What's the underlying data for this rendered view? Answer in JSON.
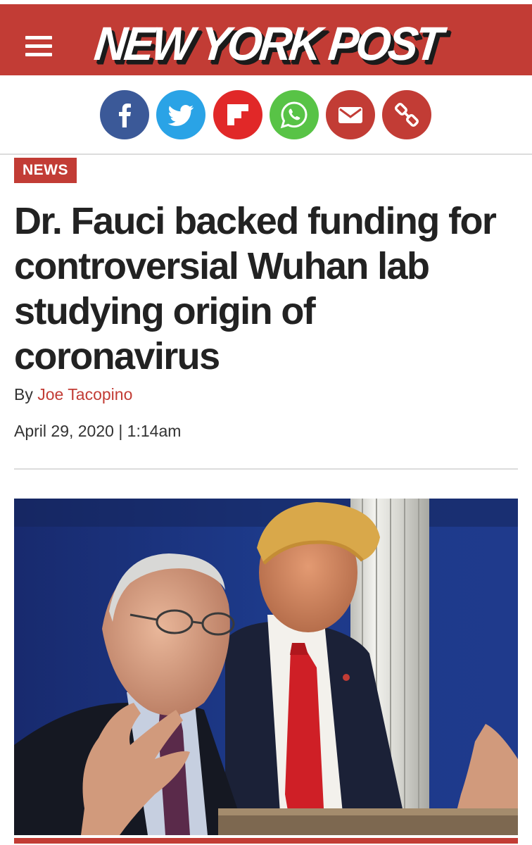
{
  "header": {
    "brand": "NEW YORK POST",
    "menu_icon": "hamburger-menu-icon",
    "brand_color": "#c23c35"
  },
  "share": [
    {
      "name": "facebook",
      "icon": "facebook-icon",
      "color": "#3b5998"
    },
    {
      "name": "twitter",
      "icon": "twitter-icon",
      "color": "#2aa3e6"
    },
    {
      "name": "flipboard",
      "icon": "flipboard-icon",
      "color": "#e12828"
    },
    {
      "name": "whatsapp",
      "icon": "whatsapp-icon",
      "color": "#58c346"
    },
    {
      "name": "email",
      "icon": "email-icon",
      "color": "#c23c35"
    },
    {
      "name": "copy-link",
      "icon": "link-icon",
      "color": "#c23c35"
    }
  ],
  "article": {
    "section": "NEWS",
    "headline": "Dr. Fauci backed funding for controversial Wuhan lab studying origin of coronavirus",
    "byline_prefix": "By ",
    "author": "Joe Tacopino",
    "date": "April 29, 2020 | 1:14am"
  }
}
